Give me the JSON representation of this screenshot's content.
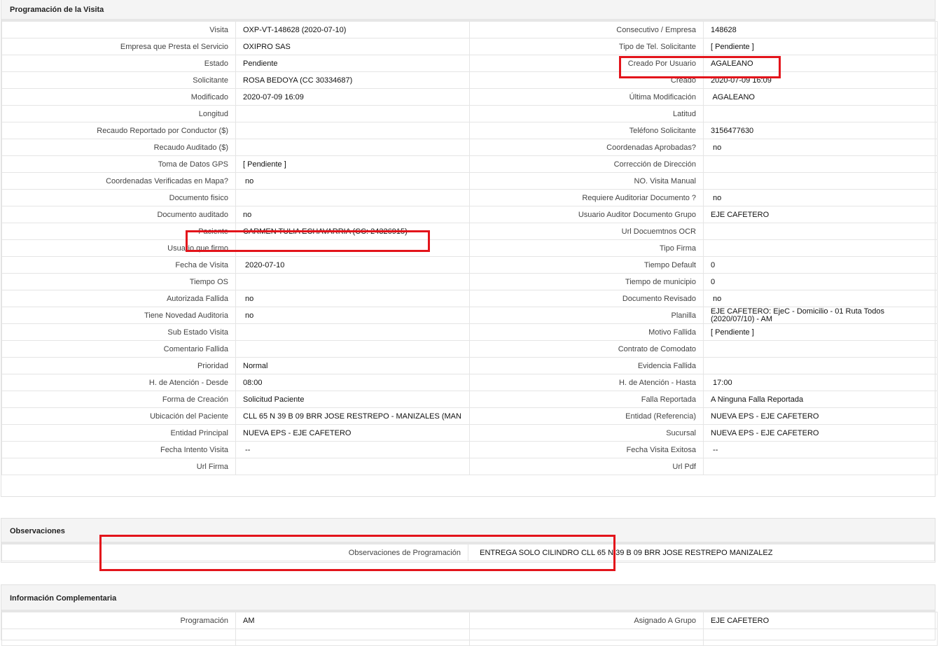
{
  "visit_section": {
    "title": "Programación de la Visita",
    "rows": [
      [
        {
          "label": "Visita",
          "value": "OXP-VT-148628 (2020-07-10)"
        },
        {
          "label": "Consecutivo / Empresa",
          "value": "148628"
        }
      ],
      [
        {
          "label": "Empresa que Presta el Servicio",
          "value": "OXIPRO SAS"
        },
        {
          "label": "Tipo de Tel. Solicitante",
          "value": "[ Pendiente ]"
        }
      ],
      [
        {
          "label": "Estado",
          "value": "Pendiente"
        },
        {
          "label": "Creado Por Usuario",
          "value": "AGALEANO"
        }
      ],
      [
        {
          "label": "Solicitante",
          "value": "ROSA BEDOYA (CC 30334687)"
        },
        {
          "label": "Creado",
          "value": "2020-07-09 16:09"
        }
      ],
      [
        {
          "label": "Modificado",
          "value": "2020-07-09 16:09"
        },
        {
          "label": "Última Modificación",
          "value": " AGALEANO"
        }
      ],
      [
        {
          "label": "Longitud",
          "value": ""
        },
        {
          "label": "Latitud",
          "value": ""
        }
      ],
      [
        {
          "label": "Recaudo Reportado por Conductor ($)",
          "value": ""
        },
        {
          "label": "Teléfono Solicitante",
          "value": "3156477630"
        }
      ],
      [
        {
          "label": "Recaudo Auditado ($)",
          "value": ""
        },
        {
          "label": "Coordenadas Aprobadas?",
          "value": " no"
        }
      ],
      [
        {
          "label": "Toma de Datos GPS",
          "value": "[ Pendiente ]"
        },
        {
          "label": "Corrección de Dirección",
          "value": ""
        }
      ],
      [
        {
          "label": "Coordenadas Verificadas en Mapa?",
          "value": " no"
        },
        {
          "label": "NO. Visita Manual",
          "value": ""
        }
      ],
      [
        {
          "label": "Documento fisico",
          "value": ""
        },
        {
          "label": "Requiere Auditoriar Documento ?",
          "value": " no"
        }
      ],
      [
        {
          "label": "Documento auditado",
          "value": "no"
        },
        {
          "label": "Usuario Auditor Documento Grupo",
          "value": "EJE CAFETERO"
        }
      ],
      [
        {
          "label": "Paciente",
          "value": "CARMEN TULIA ECHAVARRIA (CC: 24326915)"
        },
        {
          "label": "Url Docuemtnos OCR",
          "value": ""
        }
      ],
      [
        {
          "label": "Usuario que firmo",
          "value": ""
        },
        {
          "label": "Tipo Firma",
          "value": ""
        }
      ],
      [
        {
          "label": "Fecha de Visita",
          "value": " 2020-07-10"
        },
        {
          "label": "Tiempo Default",
          "value": "0"
        }
      ],
      [
        {
          "label": "Tiempo OS",
          "value": ""
        },
        {
          "label": "Tiempo de municipio",
          "value": "0"
        }
      ],
      [
        {
          "label": "Autorizada Fallida",
          "value": " no"
        },
        {
          "label": "Documento Revisado",
          "value": " no"
        }
      ],
      [
        {
          "label": "Tiene Novedad Auditoria",
          "value": " no"
        },
        {
          "label": "Planilla",
          "value": "EJE CAFETERO: EjeC - Domicilio - 01 Ruta Todos (2020/07/10) - AM"
        }
      ],
      [
        {
          "label": "Sub Estado Visita",
          "value": ""
        },
        {
          "label": "Motivo Fallida",
          "value": "[ Pendiente ]"
        }
      ],
      [
        {
          "label": "Comentario Fallida",
          "value": ""
        },
        {
          "label": "Contrato de Comodato",
          "value": ""
        }
      ],
      [
        {
          "label": "Prioridad",
          "value": "Normal"
        },
        {
          "label": "Evidencia Fallida",
          "value": ""
        }
      ],
      [
        {
          "label": "H. de Atención - Desde",
          "value": "08:00"
        },
        {
          "label": "H. de Atención - Hasta",
          "value": " 17:00"
        }
      ],
      [
        {
          "label": "Forma de Creación",
          "value": "Solicitud Paciente"
        },
        {
          "label": "Falla Reportada",
          "value": "A Ninguna Falla Reportada"
        }
      ],
      [
        {
          "label": "Ubicación del Paciente",
          "value": "CLL 65 N 39 B 09 BRR JOSE RESTREPO - MANIZALES (MAN"
        },
        {
          "label": "Entidad (Referencia)",
          "value": "NUEVA EPS - EJE CAFETERO"
        }
      ],
      [
        {
          "label": "Entidad Principal",
          "value": "NUEVA EPS - EJE CAFETERO"
        },
        {
          "label": "Sucursal",
          "value": "NUEVA EPS - EJE CAFETERO"
        }
      ],
      [
        {
          "label": "Fecha Intento Visita",
          "value": " --"
        },
        {
          "label": "Fecha Visita Exitosa",
          "value": " --"
        }
      ],
      [
        {
          "label": "Url Firma",
          "value": ""
        },
        {
          "label": "Url Pdf",
          "value": ""
        }
      ]
    ]
  },
  "observations_section": {
    "title": "Observaciones",
    "label": "Observaciones de Programación",
    "value": "  ENTREGA SOLO CILINDRO CLL 65 N 39 B 09 BRR JOSE RESTREPO MANIZALEZ"
  },
  "info_section": {
    "title": "Información Complementaria",
    "rows": [
      [
        {
          "label": "Programación",
          "value": "AM"
        },
        {
          "label": "Asignado A Grupo",
          "value": "EJE CAFETERO"
        }
      ],
      [
        {
          "label": "",
          "value": ""
        },
        {
          "label": "",
          "value": ""
        }
      ]
    ]
  },
  "highlight_color": "#e3141b"
}
